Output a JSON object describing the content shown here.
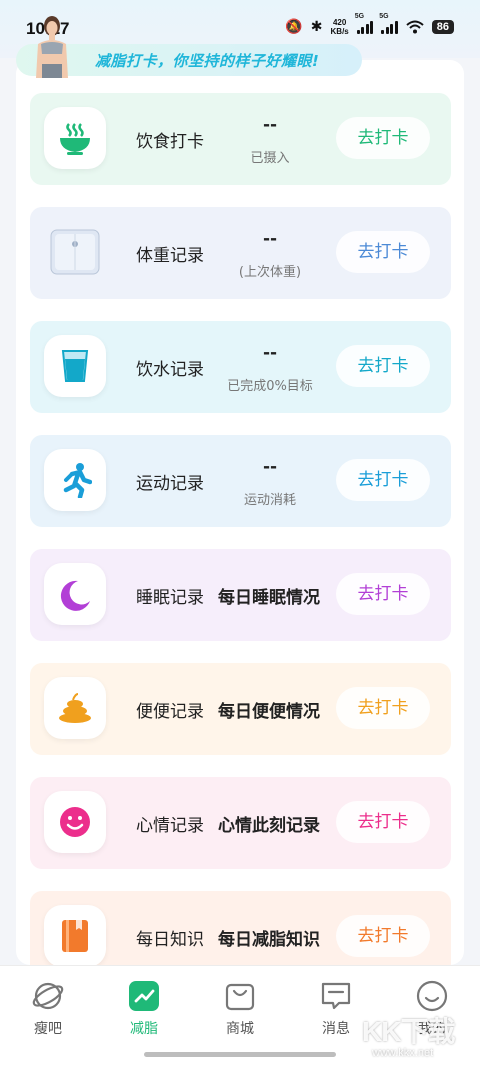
{
  "status_bar": {
    "time": "10:17",
    "net_speed_value": "420",
    "net_speed_unit": "KB/s",
    "sim1": "5G",
    "sim2": "5G",
    "battery": "86"
  },
  "banner": {
    "text": "减脂打卡，你坚持的样子好耀眼!"
  },
  "cards": [
    {
      "title": "饮食打卡",
      "value": "--",
      "sub": "已摄入",
      "button": "去打卡",
      "icon": "bowl-icon",
      "bg": "#e9f8f1",
      "accent": "#1fb978"
    },
    {
      "title": "体重记录",
      "value": "--",
      "sub": "(上次体重)",
      "button": "去打卡",
      "icon": "scale-icon",
      "bg": "#eef2fa",
      "accent": "#4c8ad6"
    },
    {
      "title": "饮水记录",
      "value": "--",
      "sub": "已完成0%目标",
      "button": "去打卡",
      "icon": "water-glass-icon",
      "bg": "#e4f6fa",
      "accent": "#13a8c9"
    },
    {
      "title": "运动记录",
      "value": "--",
      "sub": "运动消耗",
      "button": "去打卡",
      "icon": "running-icon",
      "bg": "#e8f3fb",
      "accent": "#1a9ed8"
    },
    {
      "title": "睡眠记录",
      "desc": "每日睡眠情况",
      "button": "去打卡",
      "icon": "moon-icon",
      "bg": "#f6eefb",
      "accent": "#b23fd6"
    },
    {
      "title": "便便记录",
      "desc": "每日便便情况",
      "button": "去打卡",
      "icon": "poop-icon",
      "bg": "#fff5ea",
      "accent": "#f0a01e"
    },
    {
      "title": "心情记录",
      "desc": "心情此刻记录",
      "button": "去打卡",
      "icon": "smiley-icon",
      "bg": "#fdeef4",
      "accent": "#ec2e8c"
    },
    {
      "title": "每日知识",
      "desc": "每日减脂知识",
      "button": "去打卡",
      "icon": "book-icon",
      "bg": "#fff1ea",
      "accent": "#f27a2c"
    }
  ],
  "bottom_nav": [
    {
      "label": "瘦吧",
      "icon": "planet-icon",
      "active": false
    },
    {
      "label": "减脂",
      "icon": "chart-icon",
      "active": true
    },
    {
      "label": "商城",
      "icon": "bag-icon",
      "active": false
    },
    {
      "label": "消息",
      "icon": "message-icon",
      "active": false
    },
    {
      "label": "我的",
      "icon": "smile-profile-icon",
      "active": false
    }
  ],
  "watermark": {
    "logo": "KK下载",
    "url": "www.kkx.net"
  },
  "colors": {
    "active_green": "#1fb978",
    "banner_text": "#1fb6d9"
  }
}
